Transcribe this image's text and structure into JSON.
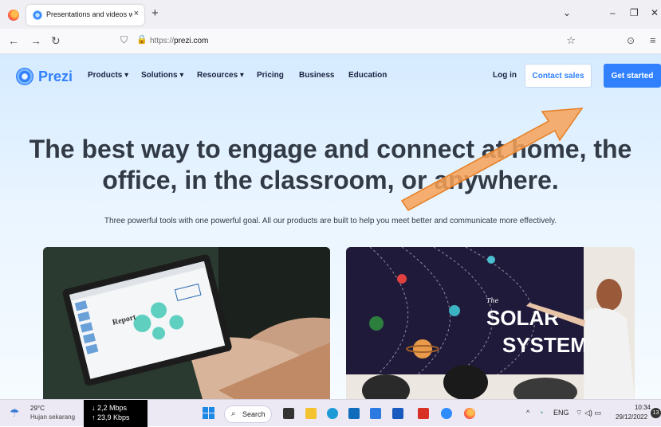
{
  "browser": {
    "tab": {
      "title": "Presentations and videos with a",
      "close": "×"
    },
    "new_tab": "+",
    "window_controls": {
      "chevron": "⌄",
      "minimize": "–",
      "maximize": "❐",
      "close": "✕"
    },
    "nav": {
      "back": "←",
      "forward": "→",
      "reload": "↻",
      "shield": "⛉",
      "lock": "🔒",
      "star": "☆",
      "pocket": "⊙",
      "menu": "≡"
    },
    "address": {
      "prefix": "https://",
      "domain": "prezi.com"
    }
  },
  "site": {
    "logo_text": "Prezi",
    "nav_items": [
      {
        "label": "Products ▾"
      },
      {
        "label": "Solutions ▾"
      },
      {
        "label": "Resources ▾"
      },
      {
        "label": "Pricing"
      },
      {
        "label": "Business"
      },
      {
        "label": "Education"
      }
    ],
    "login": "Log in",
    "contact_sales": "Contact sales",
    "get_started": "Get started",
    "headline": "The best way to engage and connect at home, the office, in the classroom, or anywhere.",
    "subheadline": "Three powerful tools with one powerful goal. All our products are built to help you meet better and communicate more effectively.",
    "card1": {
      "slide_title": "Report"
    },
    "card2": {
      "slide_small": "The",
      "slide_title_1": "SOLAR",
      "slide_title_2": "SYSTEM"
    }
  },
  "taskbar": {
    "weather": {
      "temp": "29°C",
      "desc": "Hujan sekarang"
    },
    "speed": {
      "up": "↓ 2,2 Mbps",
      "down": "↑ 23,9 Kbps"
    },
    "search": "Search",
    "tray": {
      "chevron": "^",
      "lang": "ENG",
      "icons": "⌔ ◁) ▭"
    },
    "time": "10:34",
    "date": "29/12/2022",
    "notification_count": "13"
  },
  "colors": {
    "brand": "#3181ff",
    "accent_arrow": "#f7a157",
    "heading": "#323a45"
  }
}
